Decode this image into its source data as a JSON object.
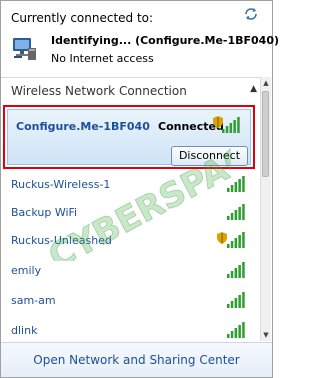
{
  "header": {
    "currently_connected_label": "Currently connected to:",
    "current_network_name": "Identifying... (Configure.Me-1BF040)",
    "current_status": "No Internet access"
  },
  "section": {
    "title": "Wireless Network Connection"
  },
  "selected": {
    "name": "Configure.Me-1BF040",
    "status": "Connected",
    "button_label": "Disconnect",
    "signal_bars": 5,
    "secured": true
  },
  "networks": [
    {
      "name": "Ruckus-Wireless-1",
      "signal_bars": 5,
      "secured": false
    },
    {
      "name": "Backup WiFi",
      "signal_bars": 5,
      "secured": false
    },
    {
      "name": "Ruckus-Unleashed",
      "signal_bars": 5,
      "secured": true
    },
    {
      "name": "emily",
      "signal_bars": 5,
      "secured": false
    },
    {
      "name": "sam-am",
      "signal_bars": 5,
      "secured": false
    },
    {
      "name": "dlink",
      "signal_bars": 5,
      "secured": false
    }
  ],
  "footer": {
    "link_label": "Open Network and Sharing Center"
  },
  "colors": {
    "link": "#1f4f9a",
    "signal": "#2e9e2e",
    "highlight_border": "#e0000c",
    "shield": "#d9a400"
  },
  "icons": {
    "refresh": "refresh-icon",
    "network": "network-computer-icon",
    "signal": "wifi-signal-icon",
    "security": "security-shield-icon",
    "collapse": "chevron-up-icon"
  },
  "watermark": {
    "text": "CYBERSPACE"
  }
}
